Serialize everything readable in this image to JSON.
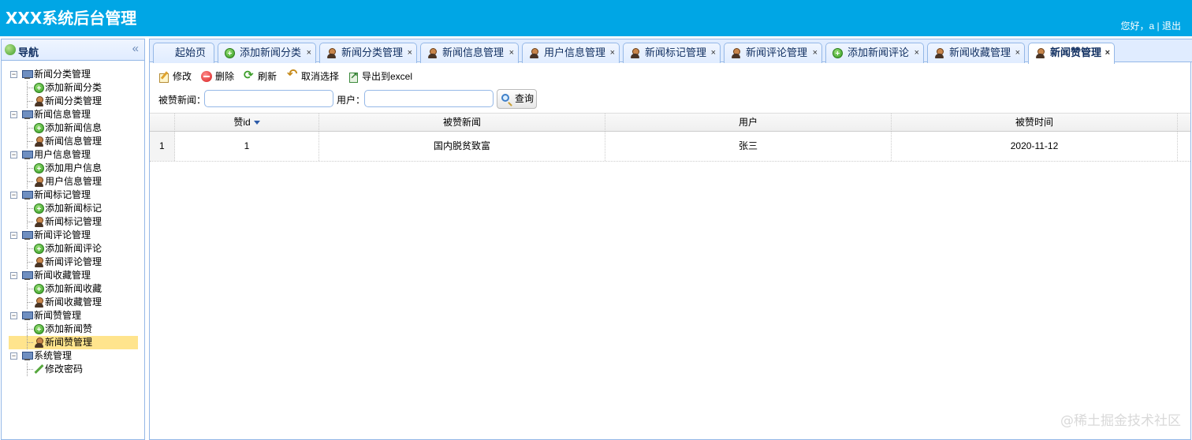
{
  "header": {
    "title": "XXX系统后台管理",
    "greeting": "您好，a",
    "separator": "|",
    "logout": "退出"
  },
  "sidebar": {
    "title": "导航",
    "groups": [
      {
        "label": "新闻分类管理",
        "children": [
          {
            "label": "添加新闻分类",
            "icon": "plus-circle-icon"
          },
          {
            "label": "新闻分类管理",
            "icon": "user-icon"
          }
        ]
      },
      {
        "label": "新闻信息管理",
        "children": [
          {
            "label": "添加新闻信息",
            "icon": "plus-circle-icon"
          },
          {
            "label": "新闻信息管理",
            "icon": "user-icon"
          }
        ]
      },
      {
        "label": "用户信息管理",
        "children": [
          {
            "label": "添加用户信息",
            "icon": "plus-circle-icon"
          },
          {
            "label": "用户信息管理",
            "icon": "user-icon"
          }
        ]
      },
      {
        "label": "新闻标记管理",
        "children": [
          {
            "label": "添加新闻标记",
            "icon": "plus-circle-icon"
          },
          {
            "label": "新闻标记管理",
            "icon": "user-icon"
          }
        ]
      },
      {
        "label": "新闻评论管理",
        "children": [
          {
            "label": "添加新闻评论",
            "icon": "plus-circle-icon"
          },
          {
            "label": "新闻评论管理",
            "icon": "user-icon"
          }
        ]
      },
      {
        "label": "新闻收藏管理",
        "children": [
          {
            "label": "添加新闻收藏",
            "icon": "plus-circle-icon"
          },
          {
            "label": "新闻收藏管理",
            "icon": "user-icon"
          }
        ]
      },
      {
        "label": "新闻赞管理",
        "children": [
          {
            "label": "添加新闻赞",
            "icon": "plus-circle-icon"
          },
          {
            "label": "新闻赞管理",
            "icon": "user-icon",
            "selected": true
          }
        ]
      },
      {
        "label": "系统管理",
        "children": [
          {
            "label": "修改密码",
            "icon": "pencil-icon"
          }
        ]
      }
    ]
  },
  "tabs": [
    {
      "label": "起始页",
      "icon": "",
      "closable": false
    },
    {
      "label": "添加新闻分类",
      "icon": "plus-circle-icon",
      "closable": true
    },
    {
      "label": "新闻分类管理",
      "icon": "user-icon",
      "closable": true
    },
    {
      "label": "新闻信息管理",
      "icon": "user-icon",
      "closable": true
    },
    {
      "label": "用户信息管理",
      "icon": "user-icon",
      "closable": true
    },
    {
      "label": "新闻标记管理",
      "icon": "user-icon",
      "closable": true
    },
    {
      "label": "新闻评论管理",
      "icon": "user-icon",
      "closable": true
    },
    {
      "label": "添加新闻评论",
      "icon": "plus-circle-icon",
      "closable": true
    },
    {
      "label": "新闻收藏管理",
      "icon": "user-icon",
      "closable": true
    },
    {
      "label": "新闻赞管理",
      "icon": "user-icon",
      "closable": true,
      "active": true
    }
  ],
  "tab_close": "×",
  "toolbar": {
    "edit": "修改",
    "delete": "删除",
    "refresh": "刷新",
    "cancel_select": "取消选择",
    "export": "导出到excel"
  },
  "search": {
    "news_label": "被赞新闻：",
    "news_value": "",
    "user_label": "用户：",
    "user_value": "",
    "query": "查询"
  },
  "grid": {
    "columns": [
      "赞id",
      "被赞新闻",
      "用户",
      "被赞时间"
    ],
    "rows": [
      {
        "num": "1",
        "id": "1",
        "news": "国内脱贫致富",
        "user": "张三",
        "time": "2020-11-12"
      }
    ]
  },
  "watermark": "@稀土掘金技术社区"
}
